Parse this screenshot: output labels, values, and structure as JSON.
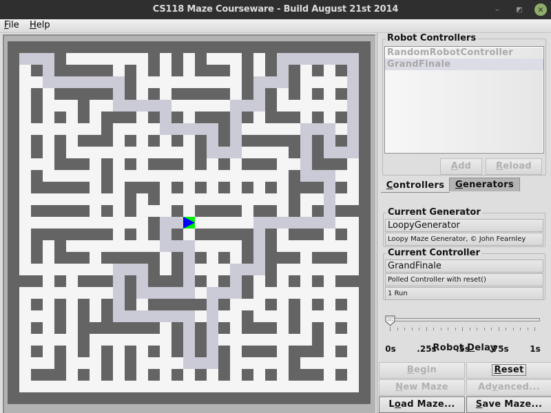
{
  "window": {
    "title": "CS118 Maze Courseware - Build August 21st 2014",
    "minimize_glyph": "–",
    "maximize_glyph": "◩",
    "close_glyph": "✕"
  },
  "menu": {
    "items": [
      {
        "label_mnemonic": "F",
        "label_rest": "ile"
      },
      {
        "label_mnemonic": "H",
        "label_rest": "elp"
      }
    ]
  },
  "maze": {
    "rows": 31,
    "cols": 31,
    "legend": {
      "#": "wall",
      ".": "open",
      "p": "path",
      "R": "robot"
    },
    "colors": {
      "wall": "#646464",
      "open": "#f5f5f5",
      "path": "#cbcbd7",
      "robot_bg": "#00f000",
      "robot_arrow": "#0000ff"
    },
    "robot": {
      "row": 15,
      "col": 15,
      "heading": "east"
    },
    "grid": [
      "###############################",
      "#ppp#.......#.#.#...#.#ppppppp#",
      "#.#p#####.#.#.#.###.#.#p#.#.#p#",
      "#..ppppppp#.........#ppp#....p#",
      "#.#.#####p#.#.#####.#p#.#.#.#p#",
      "#.#...#..ppppp.....ppp#......p#",
      "#.#.#.#.###.#p#.###p#.###.#.#p#",
      "#.......#....ppppp#p.....ppp.p#",
      "#.#.#.###.#.#.#.#p#p#####p#p#p#",
      "#.#.#...........#ppp....#p#ppp#",
      "#...###.#.#.###.#.#.###..p###.#",
      "#.#.....#...............#ppp..#",
      "#.#####.#.###.#.#.#.#.#.###p#.#",
      "#.........#.#...........#..p..#",
      "#.#####.#.#...#.####.##.#.#p###",
      "#...........#ppR.....ppppppp..#",
      "#.#######.#.#p#.#####p#.###.#.#",
      "#.#.#........ppp....#p#.......#",
      "#.#.###.#####.#p#.#.#p###.###.#",
      "#........ppp#.#p...ppp#.......#",
      "###.#.###p#p###p#.#p#.#.#.#.###",
      "#........p#ppppp.ppp#.........#",
      "#.#.#.#.#p#.#####p#...#.#.#.#.#",
      "#...#.#.#ppppppp.p..#...#.....#",
      "#.#.#.#######.#p#p#.###.#.#.#.#",
      "#.....#.......#p#p........#...#",
      "#.#.#.#.#.#.#.#p#p#.###.###.#.#",
      "#...#...#.#....ppp#.....#.....#",
      "#.###.#.#.#.#.#.#.#.#.#.###.#.#",
      "#.............................#",
      "###############################"
    ]
  },
  "robot_controllers": {
    "title": "Robot Controllers",
    "items": [
      {
        "label": "RandomRobotController",
        "selected": false
      },
      {
        "label": "GrandFinale",
        "selected": true
      }
    ],
    "add_button": {
      "mnemonic": "A",
      "rest": "dd",
      "enabled": false
    },
    "reload_button": {
      "mnemonic": "R",
      "rest": "eload",
      "enabled": false
    }
  },
  "tabs": [
    {
      "mnemonic": "C",
      "rest": "ontrollers",
      "active": true
    },
    {
      "mnemonic": "G",
      "rest": "enerators",
      "active": false
    }
  ],
  "current_generator": {
    "title": "Current Generator",
    "name": "LoopyGenerator",
    "description": "Loopy Maze Generator, © John Fearnley"
  },
  "current_controller": {
    "title": "Current Controller",
    "name": "GrandFinale",
    "description": "Polled Controller with reset()",
    "runs": "1 Run"
  },
  "robot_delay": {
    "caption_before": "Robot ",
    "caption_mnemonic": "D",
    "caption_after": "elay",
    "min_s": 0,
    "max_s": 1,
    "value_s": 0,
    "minor_tick_step_s": 0.05,
    "labels": [
      {
        "value": 0,
        "text": "0s"
      },
      {
        "value": 0.25,
        "text": ".25s"
      },
      {
        "value": 0.5,
        "text": ".5s"
      },
      {
        "value": 0.75,
        "text": ".75s"
      },
      {
        "value": 1,
        "text": "1s"
      }
    ]
  },
  "buttons": {
    "begin": {
      "before": "",
      "mnemonic": "B",
      "after": "egin",
      "enabled": false
    },
    "reset": {
      "before": "",
      "mnemonic": "R",
      "after": "eset",
      "enabled": true
    },
    "new_maze": {
      "before": "",
      "mnemonic": "N",
      "after": "ew Maze",
      "enabled": false
    },
    "advanced": {
      "before": "Ad",
      "mnemonic": "v",
      "after": "anced...",
      "enabled": false
    },
    "load_maze": {
      "before": "L",
      "mnemonic": "o",
      "after": "ad Maze...",
      "enabled": true
    },
    "save_maze": {
      "before": "",
      "mnemonic": "S",
      "after": "ave Maze...",
      "enabled": true
    }
  }
}
